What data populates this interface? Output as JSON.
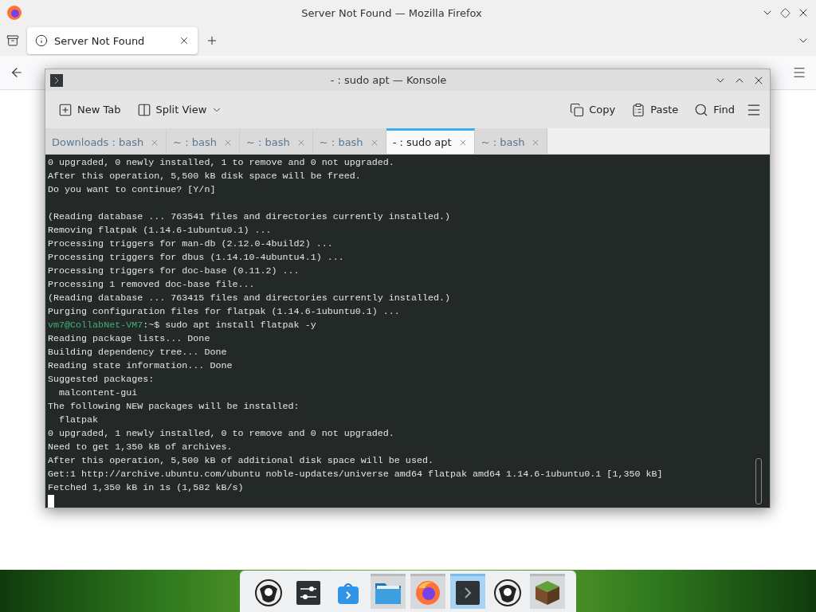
{
  "firefox": {
    "title": "Server Not Found — Mozilla Firefox",
    "tabs": [
      {
        "label": "Server Not Found",
        "selected": true
      }
    ]
  },
  "konsole": {
    "title": "- : sudo apt — Konsole",
    "toolbar_left": [
      {
        "kind": "new-tab",
        "label": "New Tab"
      },
      {
        "kind": "split-view",
        "label": "Split View"
      }
    ],
    "toolbar_right": [
      {
        "kind": "copy",
        "label": "Copy"
      },
      {
        "kind": "paste",
        "label": "Paste"
      },
      {
        "kind": "find",
        "label": "Find"
      }
    ],
    "tabs": [
      {
        "label": "Downloads : bash",
        "selected": false
      },
      {
        "label": "~ : bash",
        "selected": false
      },
      {
        "label": "~ : bash",
        "selected": false
      },
      {
        "label": "~ : bash",
        "selected": false
      },
      {
        "label": "- : sudo apt",
        "selected": true
      },
      {
        "label": "~ : bash",
        "selected": false
      }
    ],
    "lines": [
      {
        "kind": "output",
        "text": "0 upgraded, 0 newly installed, 1 to remove and 0 not upgraded."
      },
      {
        "kind": "output",
        "text": "After this operation, 5,500 kB disk space will be freed."
      },
      {
        "kind": "output",
        "text": "Do you want to continue? [Y/n]"
      },
      {
        "kind": "blank"
      },
      {
        "kind": "output",
        "text": "(Reading database ... 763541 files and directories currently installed.)"
      },
      {
        "kind": "output",
        "text": "Removing flatpak (1.14.6-1ubuntu0.1) ..."
      },
      {
        "kind": "output",
        "text": "Processing triggers for man-db (2.12.0-4build2) ..."
      },
      {
        "kind": "output",
        "text": "Processing triggers for dbus (1.14.10-4ubuntu4.1) ..."
      },
      {
        "kind": "output",
        "text": "Processing triggers for doc-base (0.11.2) ..."
      },
      {
        "kind": "output",
        "text": "Processing 1 removed doc-base file..."
      },
      {
        "kind": "output",
        "text": "(Reading database ... 763415 files and directories currently installed.)"
      },
      {
        "kind": "output",
        "text": "Purging configuration files for flatpak (1.14.6-1ubuntu0.1) ..."
      },
      {
        "kind": "prompt",
        "prompt": "vm7@CollabNet-VM7",
        "text": ":~$ sudo apt install flatpak -y"
      },
      {
        "kind": "output",
        "text": "Reading package lists... Done"
      },
      {
        "kind": "output",
        "text": "Building dependency tree... Done"
      },
      {
        "kind": "output",
        "text": "Reading state information... Done"
      },
      {
        "kind": "output",
        "text": "Suggested packages:"
      },
      {
        "kind": "output",
        "text": "  malcontent-gui"
      },
      {
        "kind": "output",
        "text": "The following NEW packages will be installed:"
      },
      {
        "kind": "output",
        "text": "  flatpak"
      },
      {
        "kind": "output",
        "text": "0 upgraded, 1 newly installed, 0 to remove and 0 not upgraded."
      },
      {
        "kind": "output",
        "text": "Need to get 1,350 kB of archives."
      },
      {
        "kind": "output",
        "text": "After this operation, 5,500 kB of additional disk space will be used."
      },
      {
        "kind": "output",
        "text": "Get:1 http://archive.ubuntu.com/ubuntu noble-updates/universe amd64 flatpak amd64 1.14.6-1ubuntu0.1 [1,350 kB]"
      },
      {
        "kind": "output",
        "text": "Fetched 1,350 kB in 1s (1,582 kB/s)"
      },
      {
        "kind": "cursor"
      }
    ]
  },
  "dock": {
    "items": [
      {
        "kind": "mascot",
        "running": false,
        "selected": false
      },
      {
        "kind": "sliders",
        "running": false,
        "selected": false
      },
      {
        "kind": "bag",
        "running": false,
        "selected": false
      },
      {
        "kind": "folder",
        "running": true,
        "selected": false
      },
      {
        "kind": "browser",
        "running": true,
        "selected": false
      },
      {
        "kind": "terminal",
        "running": true,
        "selected": true
      },
      {
        "kind": "mascot",
        "running": false,
        "selected": false
      },
      {
        "kind": "cube",
        "running": true,
        "selected": false
      }
    ]
  }
}
